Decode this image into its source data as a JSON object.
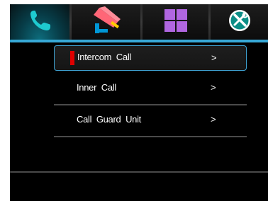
{
  "tabs": [
    {
      "icon": "phone-icon",
      "active": true
    },
    {
      "icon": "security-camera-icon",
      "active": false
    },
    {
      "icon": "apps-grid-icon",
      "active": false
    },
    {
      "icon": "settings-tools-icon",
      "active": false
    }
  ],
  "menu": {
    "items": [
      {
        "label": "Intercom  Call",
        "arrow": ">",
        "selected": true
      },
      {
        "label": "Inner  Call",
        "arrow": ">",
        "selected": false
      },
      {
        "label": "Call  Guard  Unit",
        "arrow": ">",
        "selected": false
      }
    ]
  },
  "colors": {
    "accent": "#38a9d7",
    "selection_marker": "#e00000",
    "phone_icon": "#1ecad0",
    "apps_icon": "#b066e0",
    "camera_pink": "#ff6677",
    "camera_yellow": "#ffcc00",
    "camera_blue": "#0097d6"
  }
}
